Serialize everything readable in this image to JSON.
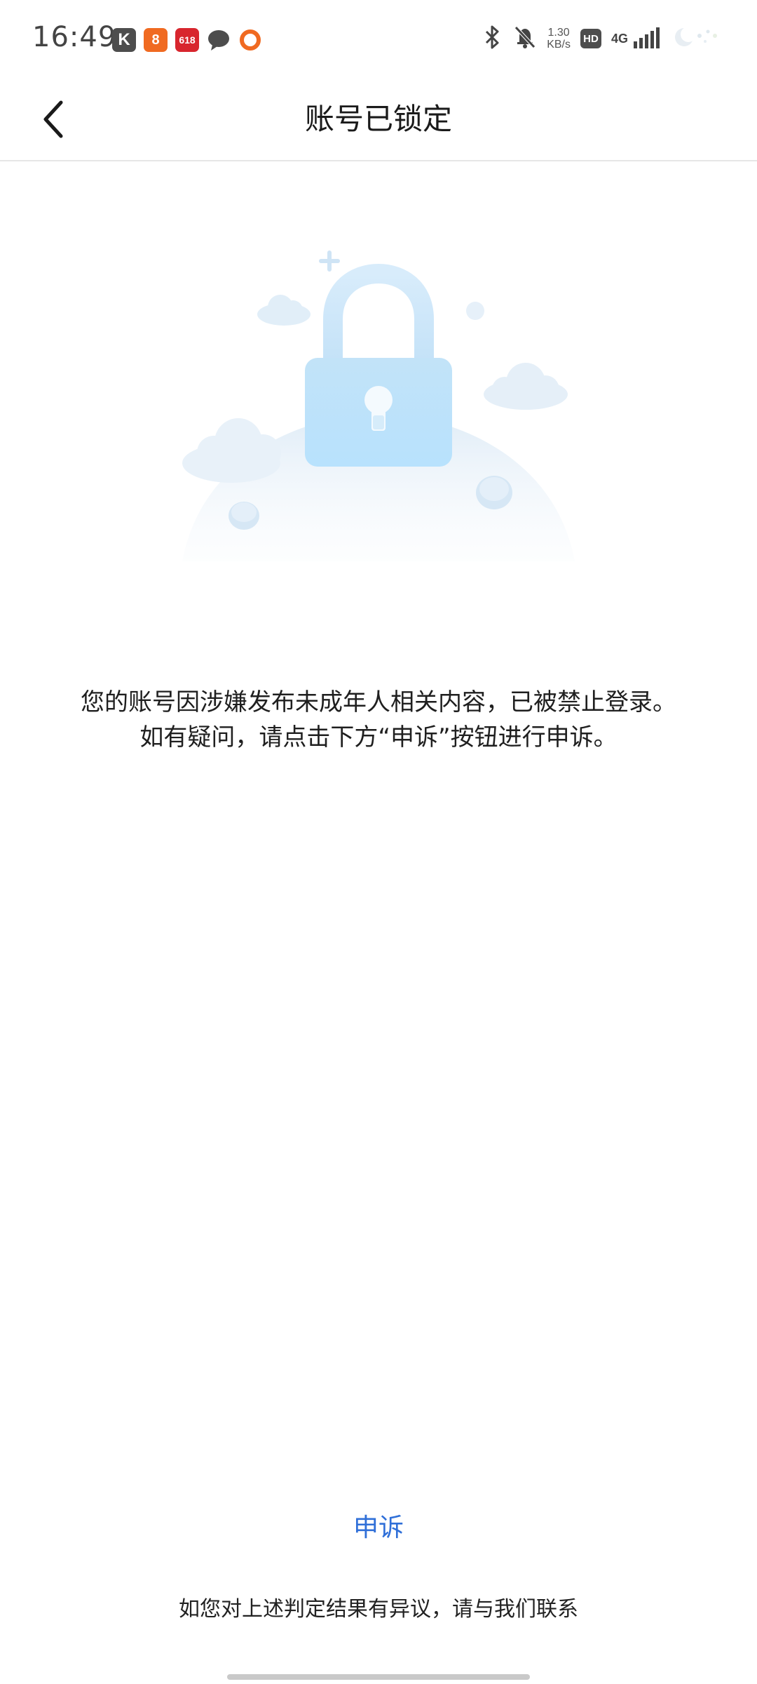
{
  "status_bar": {
    "time": "16:49",
    "app_icons": [
      "k-app-icon",
      "orange-app-icon",
      "618-app-icon",
      "message-icon",
      "ring-app-icon"
    ],
    "k_label": "K",
    "orange_label": "8",
    "badge_618": "618",
    "net_speed_value": "1.30",
    "net_speed_unit": "KB/s",
    "hd_label": "HD",
    "network_type": "4G"
  },
  "nav": {
    "title": "账号已锁定"
  },
  "message": {
    "line1": "您的账号因涉嫌发布未成年人相关内容，已被禁止登录。",
    "line2": "如有疑问，请点击下方“申诉”按钮进行申诉。"
  },
  "appeal_label": "申诉",
  "contact_text": "如您对上述判定结果有异议，请与我们联系",
  "colors": {
    "accent": "#2f6fd8",
    "lock": "#bde3fb",
    "divider": "#e6e6e6"
  }
}
